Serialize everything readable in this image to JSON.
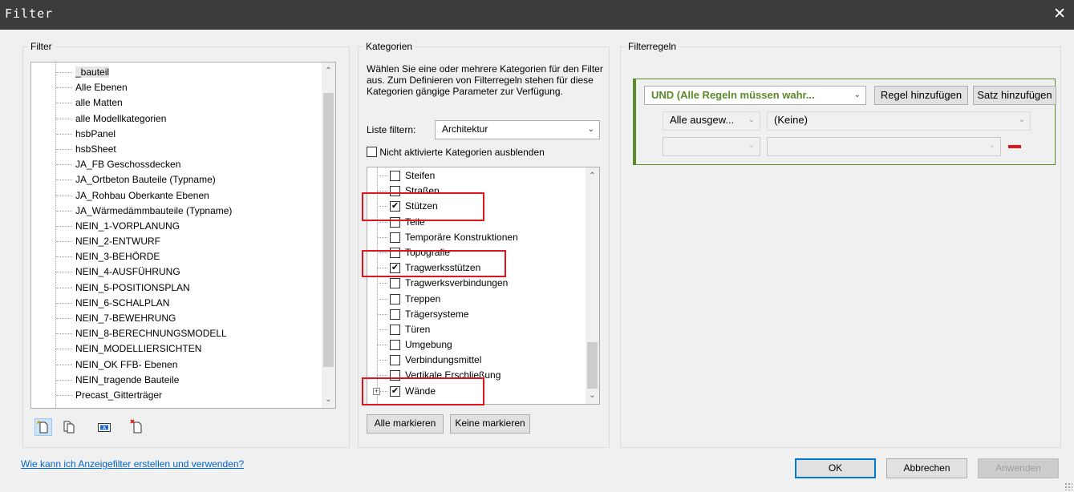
{
  "window": {
    "title": "Filter",
    "close_glyph": "✕"
  },
  "filter_panel": {
    "label": "Filter",
    "items": [
      "_bauteil",
      "Alle Ebenen",
      "alle Matten",
      "alle Modellkategorien",
      "hsbPanel",
      "hsbSheet",
      "JA_FB Geschossdecken",
      "JA_Ortbeton Bauteile (Typname)",
      "JA_Rohbau Oberkante Ebenen",
      "JA_Wärmedämmbauteile (Typname)",
      "NEIN_1-VORPLANUNG",
      "NEIN_2-ENTWURF",
      "NEIN_3-BEHÖRDE",
      "NEIN_4-AUSFÜHRUNG",
      "NEIN_5-POSITIONSPLAN",
      "NEIN_6-SCHALPLAN",
      "NEIN_7-BEWEHRUNG",
      "NEIN_8-BERECHNUNGSMODELL",
      "NEIN_MODELLIERSICHTEN",
      "NEIN_OK FFB- Ebenen",
      "NEIN_tragende Bauteile",
      "Precast_Gitterträger"
    ],
    "selected_index": 0,
    "icons": [
      "new-filter-icon",
      "duplicate-filter-icon",
      "rename-filter-icon",
      "delete-filter-icon"
    ]
  },
  "categories_panel": {
    "label": "Kategorien",
    "description": "Wählen Sie eine oder mehrere Kategorien für den Filter aus. Zum Definieren von Filterregeln stehen für diese Kategorien gängige Parameter zur Verfügung.",
    "list_filter_label": "Liste filtern:",
    "list_filter_value": "Architektur",
    "hide_unchecked_label": "Nicht aktivierte Kategorien ausblenden",
    "hide_unchecked_checked": false,
    "items": [
      {
        "label": "Steifen",
        "checked": false
      },
      {
        "label": "Straßen",
        "checked": false
      },
      {
        "label": "Stützen",
        "checked": true
      },
      {
        "label": "Teile",
        "checked": false
      },
      {
        "label": "Temporäre Konstruktionen",
        "checked": false
      },
      {
        "label": "Topografie",
        "checked": false
      },
      {
        "label": "Tragwerksstützen",
        "checked": true
      },
      {
        "label": "Tragwerksverbindungen",
        "checked": false
      },
      {
        "label": "Treppen",
        "checked": false
      },
      {
        "label": "Trägersysteme",
        "checked": false
      },
      {
        "label": "Türen",
        "checked": false
      },
      {
        "label": "Umgebung",
        "checked": false
      },
      {
        "label": "Verbindungsmittel",
        "checked": false
      },
      {
        "label": "Vertikale Erschließung",
        "checked": false
      },
      {
        "label": "Wände",
        "checked": true,
        "expandable": true
      }
    ],
    "check_all_label": "Alle markieren",
    "check_none_label": "Keine markieren"
  },
  "rules_panel": {
    "label": "Filterregeln",
    "logic_value": "UND (Alle Regeln müssen wahr...",
    "add_rule_label": "Regel hinzufügen",
    "add_set_label": "Satz hinzufügen",
    "row1_param": "Alle ausgew...",
    "row1_value": "(Keine)",
    "accent_color": "#5b8a2a",
    "remove_color": "#e0141e"
  },
  "footer": {
    "help_link": "Wie kann ich Anzeigefilter erstellen und verwenden?",
    "ok_label": "OK",
    "cancel_label": "Abbrechen",
    "apply_label": "Anwenden"
  }
}
